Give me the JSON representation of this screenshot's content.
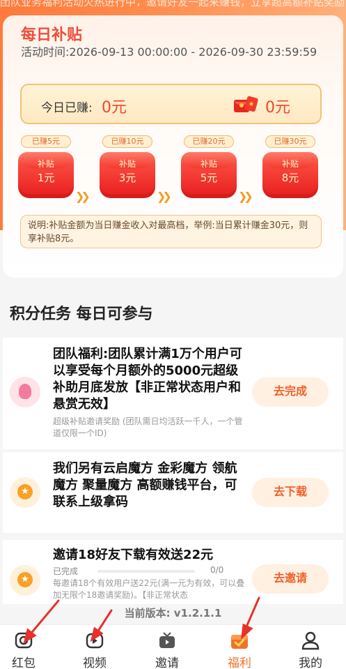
{
  "top_strip": {
    "text": "团队业务福利活动火热进行中，邀请好友一起来赚钱，立享超高额补贴奖励"
  },
  "subsidy": {
    "title": "每日补贴",
    "activity_time": "活动时间:2026-09-13 00:00:00 - 2026-09-30 23:59:59",
    "earned_label": "今日已赚:",
    "earned_value": "0元",
    "bonus_value": "0元",
    "tiers": [
      {
        "label": "已赚5元",
        "name": "补贴",
        "amount": "1元"
      },
      {
        "label": "已赚10元",
        "name": "补贴",
        "amount": "3元"
      },
      {
        "label": "已赚20元",
        "name": "补贴",
        "amount": "5元"
      },
      {
        "label": "已赚30元",
        "name": "补贴",
        "amount": "8元"
      }
    ],
    "note": "说明:补贴金额为当日赚金收入对最高档，举例:当日累计赚金30元，则享补贴8元。"
  },
  "tasks_section": {
    "title": "积分任务  每日可参与"
  },
  "tasks": [
    {
      "icon": "user-pink-icon",
      "text": "团队福利:团队累计满1万个用户可以享受每个月额外的5000元超级补助月底发放【非正常状态用户和悬赏无效】",
      "sub": "超级补贴邀请奖励 (团队需日均活跃一千人，一个管道仅限一个ID)",
      "button": "去完成"
    },
    {
      "icon": "star-coin-icon",
      "text": "我们另有云启魔方 金彩魔方 领航魔方 聚量魔方 高额赚钱平台，可联系上级拿码",
      "button": "去下载"
    },
    {
      "icon": "star-coin-icon",
      "text": "邀请18好友下载有效送22元",
      "progress_label": "已完成",
      "progress_count": "0/0",
      "progress": 0,
      "sub": "每邀请18个有效用户送22元(满一元为有效，可以叠加无限个18邀请奖励)。【非正常状态",
      "button": "去邀请"
    }
  ],
  "version": "当前版本: v1.2.1.1",
  "tabbar": [
    {
      "label": "红包",
      "icon": "camera-icon",
      "active": false
    },
    {
      "label": "视频",
      "icon": "video-icon",
      "active": false
    },
    {
      "label": "邀请",
      "icon": "tv-icon",
      "active": false
    },
    {
      "label": "福利",
      "icon": "gift-check-icon",
      "active": true
    },
    {
      "label": "我的",
      "icon": "person-icon",
      "active": false
    }
  ],
  "colors": {
    "accent": "#f2722a",
    "red": "#f0462b",
    "annotation": "#e8302a"
  }
}
